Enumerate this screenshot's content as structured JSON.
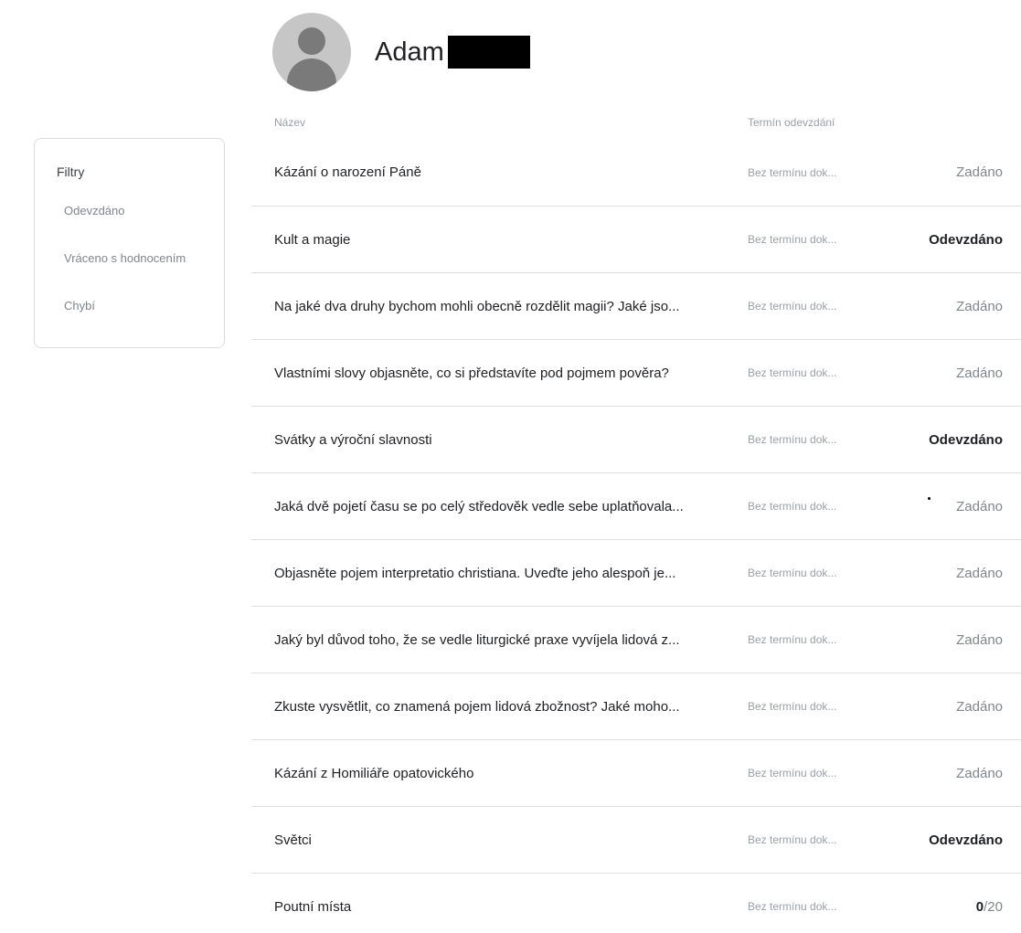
{
  "student": {
    "name": "Adam"
  },
  "filters": {
    "title": "Filtry",
    "items": [
      {
        "label": "Odevzdáno"
      },
      {
        "label": "Vráceno s hodnocením"
      },
      {
        "label": "Chybí"
      }
    ]
  },
  "table": {
    "columns": {
      "name": "Název",
      "due": "Termín odevzdání"
    },
    "rows": [
      {
        "title": "Kázání o narození Páně",
        "due": "Bez termínu dok...",
        "status": "Zadáno"
      },
      {
        "title": "Kult a magie",
        "due": "Bez termínu dok...",
        "status": "Odevzdáno"
      },
      {
        "title": "Na jaké dva druhy bychom mohli obecně rozdělit magii? Jaké jso...",
        "due": "Bez termínu dok...",
        "status": "Zadáno"
      },
      {
        "title": "Vlastními slovy objasněte, co si představíte pod pojmem pověra?",
        "due": "Bez termínu dok...",
        "status": "Zadáno"
      },
      {
        "title": "Svátky a výroční slavnosti",
        "due": "Bez termínu dok...",
        "status": "Odevzdáno"
      },
      {
        "title": "Jaká dvě pojetí času se po celý středověk vedle sebe uplatňovala...",
        "due": "Bez termínu dok...",
        "status": "Zadáno"
      },
      {
        "title": "Objasněte pojem interpretatio christiana. Uveďte jeho alespoň je...",
        "due": "Bez termínu dok...",
        "status": "Zadáno"
      },
      {
        "title": "Jaký byl důvod toho, že se vedle liturgické praxe vyvíjela lidová z...",
        "due": "Bez termínu dok...",
        "status": "Zadáno"
      },
      {
        "title": "Zkuste vysvětlit, co znamená pojem lidová zbožnost? Jaké moho...",
        "due": "Bez termínu dok...",
        "status": "Zadáno"
      },
      {
        "title": "Kázání z Homiliáře opatovického",
        "due": "Bez termínu dok...",
        "status": "Zadáno"
      },
      {
        "title": "Světci",
        "due": "Bez termínu dok...",
        "status": "Odevzdáno"
      },
      {
        "title": "Poutní místa",
        "due": "Bez termínu dok...",
        "grade": {
          "value": "0",
          "max": "/20"
        }
      }
    ]
  }
}
